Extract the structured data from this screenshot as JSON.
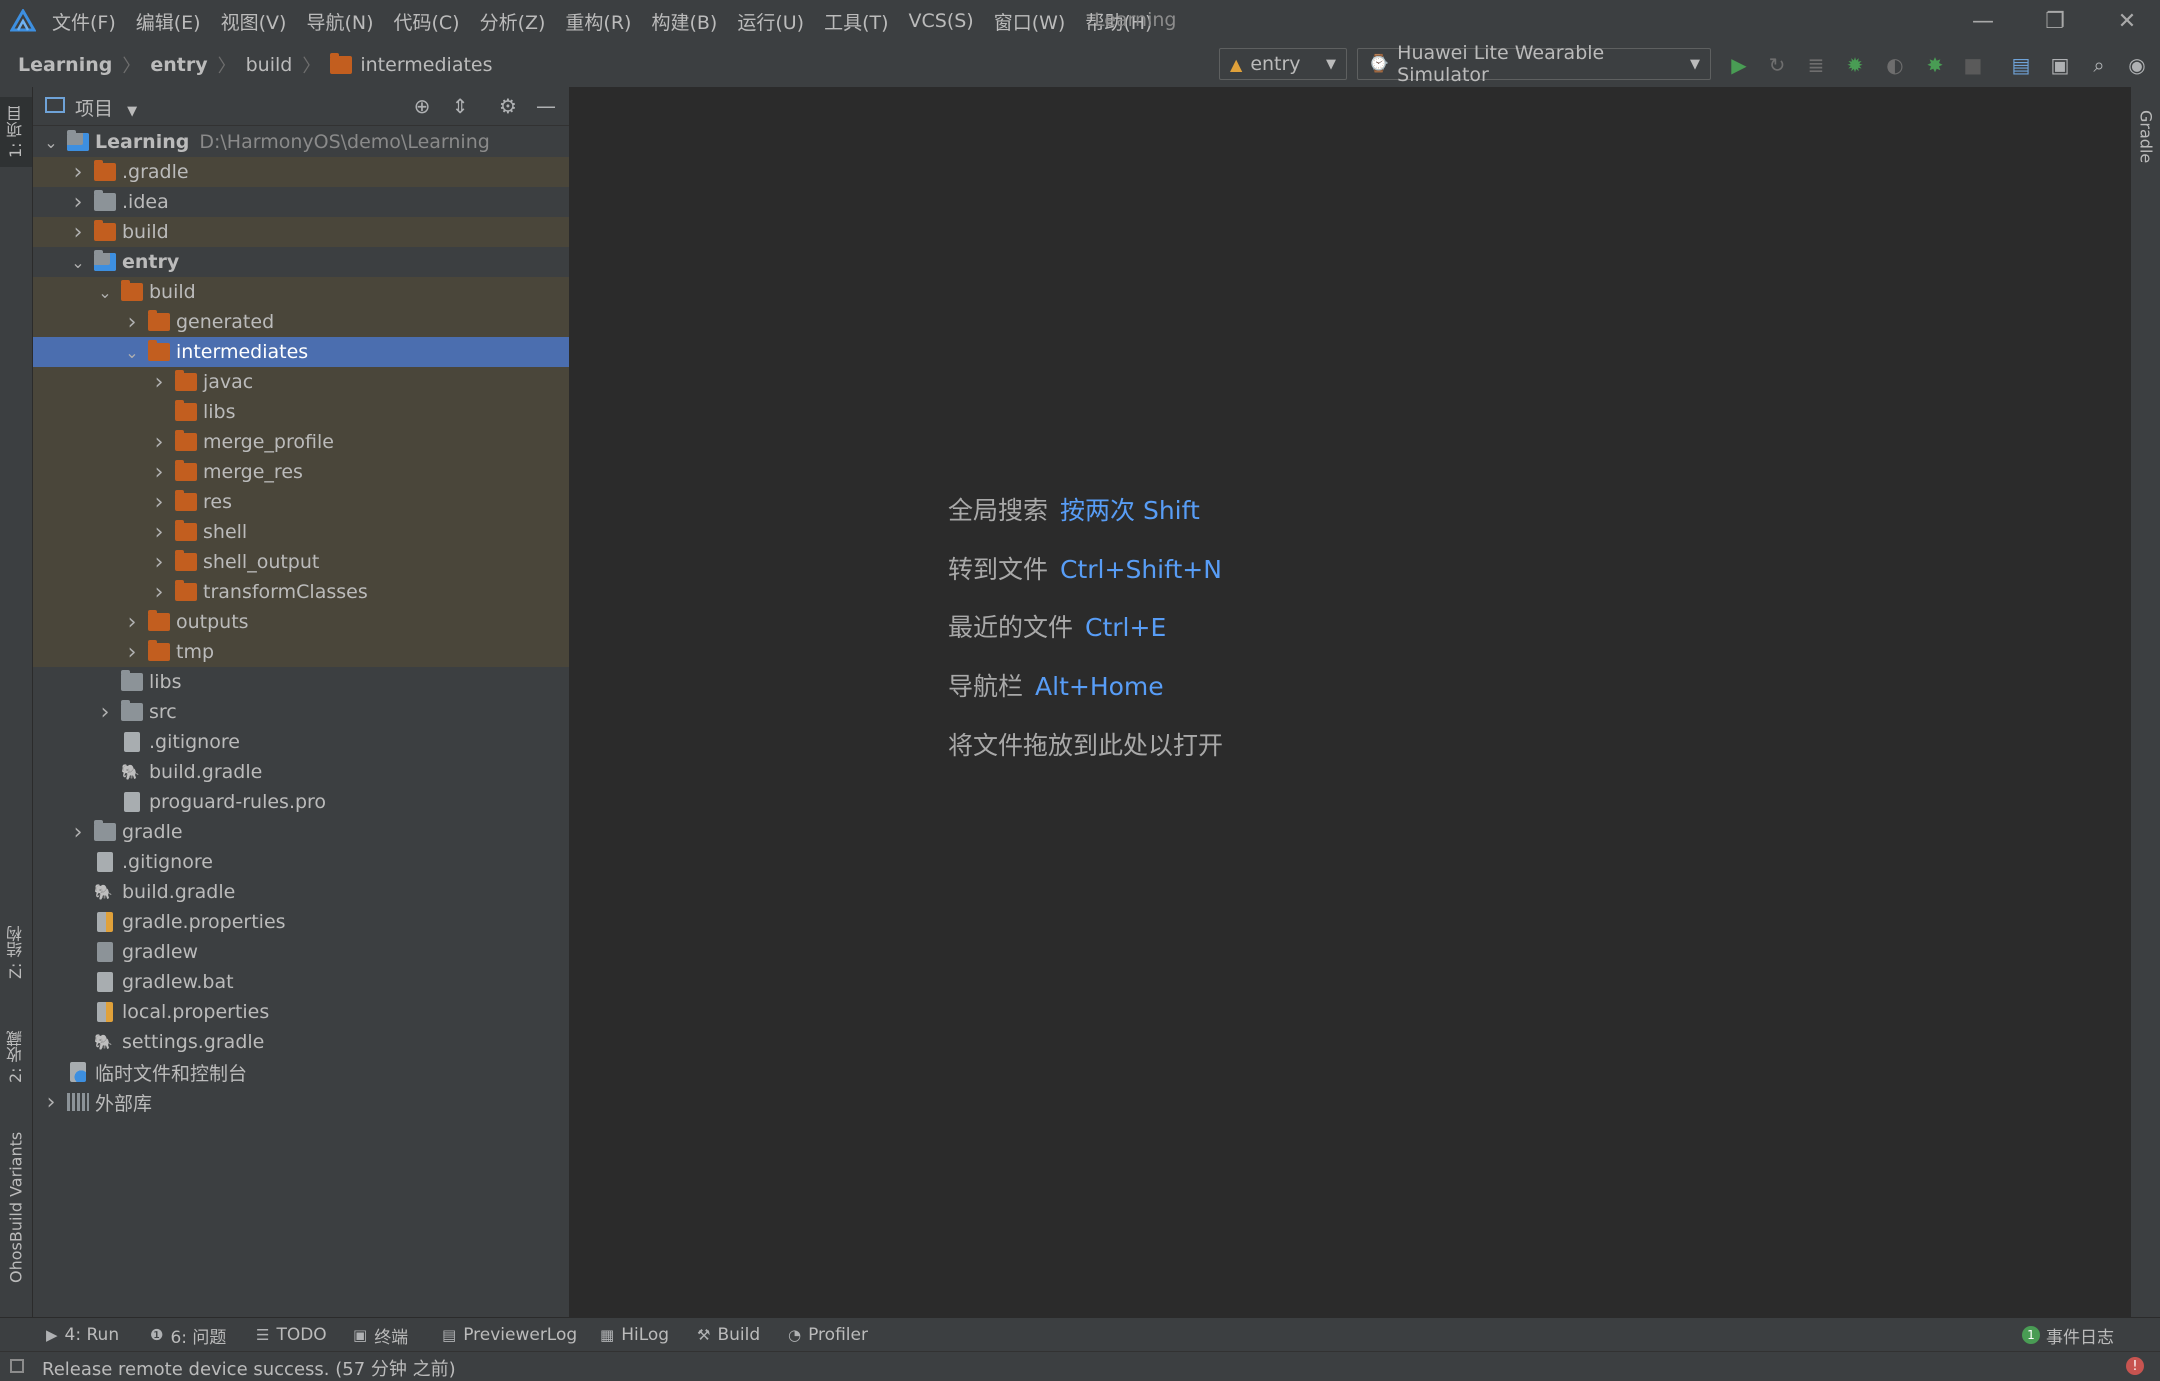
{
  "menubar": {
    "items": [
      "文件(F)",
      "编辑(E)",
      "视图(V)",
      "导航(N)",
      "代码(C)",
      "分析(Z)",
      "重构(R)",
      "构建(B)",
      "运行(U)",
      "工具(T)",
      "VCS(S)",
      "窗口(W)",
      "帮助(H)"
    ],
    "window_title": "Learning"
  },
  "breadcrumb": [
    "Learning",
    "entry",
    "build",
    "intermediates"
  ],
  "toolbar": {
    "run_config": "entry",
    "device": "Huawei Lite Wearable Simulator"
  },
  "left_strip": {
    "project_tab": "1: 项目",
    "structure_tab": "Z: 结构",
    "favorites_tab": "2: 收藏",
    "variants_tab": "OhosBuild Variants"
  },
  "right_strip": {
    "gradle_tab": "Gradle"
  },
  "project_panel": {
    "title": "项目",
    "tree": [
      {
        "indent": 0,
        "arrow": "down",
        "icon": "module",
        "label": "Learning",
        "sub": "D:\\HarmonyOS\\demo\\Learning",
        "bold": true
      },
      {
        "indent": 1,
        "arrow": "right",
        "icon": "folder-orange",
        "label": ".gradle",
        "hl": true
      },
      {
        "indent": 1,
        "arrow": "right",
        "icon": "folder",
        "label": ".idea"
      },
      {
        "indent": 1,
        "arrow": "right",
        "icon": "folder-orange",
        "label": "build",
        "hl": true
      },
      {
        "indent": 1,
        "arrow": "down",
        "icon": "module",
        "label": "entry",
        "bold": true
      },
      {
        "indent": 2,
        "arrow": "down",
        "icon": "folder-orange",
        "label": "build",
        "hl": true
      },
      {
        "indent": 3,
        "arrow": "right",
        "icon": "folder-orange",
        "label": "generated",
        "hl": true
      },
      {
        "indent": 3,
        "arrow": "down",
        "icon": "folder-orange",
        "label": "intermediates",
        "sel": true
      },
      {
        "indent": 4,
        "arrow": "right",
        "icon": "folder-orange",
        "label": "javac",
        "hl": true
      },
      {
        "indent": 4,
        "arrow": "",
        "icon": "folder-orange",
        "label": "libs",
        "hl": true
      },
      {
        "indent": 4,
        "arrow": "right",
        "icon": "folder-orange",
        "label": "merge_profile",
        "hl": true
      },
      {
        "indent": 4,
        "arrow": "right",
        "icon": "folder-orange",
        "label": "merge_res",
        "hl": true
      },
      {
        "indent": 4,
        "arrow": "right",
        "icon": "folder-orange",
        "label": "res",
        "hl": true
      },
      {
        "indent": 4,
        "arrow": "right",
        "icon": "folder-orange",
        "label": "shell",
        "hl": true
      },
      {
        "indent": 4,
        "arrow": "right",
        "icon": "folder-orange",
        "label": "shell_output",
        "hl": true
      },
      {
        "indent": 4,
        "arrow": "right",
        "icon": "folder-orange",
        "label": "transformClasses",
        "hl": true
      },
      {
        "indent": 3,
        "arrow": "right",
        "icon": "folder-orange",
        "label": "outputs",
        "hl": true
      },
      {
        "indent": 3,
        "arrow": "right",
        "icon": "folder-orange",
        "label": "tmp",
        "hl": true
      },
      {
        "indent": 2,
        "arrow": "",
        "icon": "folder",
        "label": "libs"
      },
      {
        "indent": 2,
        "arrow": "right",
        "icon": "folder",
        "label": "src"
      },
      {
        "indent": 2,
        "arrow": "",
        "icon": "file",
        "label": ".gitignore"
      },
      {
        "indent": 2,
        "arrow": "",
        "icon": "gradle",
        "label": "build.gradle"
      },
      {
        "indent": 2,
        "arrow": "",
        "icon": "file",
        "label": "proguard-rules.pro"
      },
      {
        "indent": 1,
        "arrow": "right",
        "icon": "folder",
        "label": "gradle"
      },
      {
        "indent": 1,
        "arrow": "",
        "icon": "file",
        "label": ".gitignore"
      },
      {
        "indent": 1,
        "arrow": "",
        "icon": "gradle",
        "label": "build.gradle"
      },
      {
        "indent": 1,
        "arrow": "",
        "icon": "props",
        "label": "gradle.properties"
      },
      {
        "indent": 1,
        "arrow": "",
        "icon": "shell",
        "label": "gradlew"
      },
      {
        "indent": 1,
        "arrow": "",
        "icon": "file",
        "label": "gradlew.bat"
      },
      {
        "indent": 1,
        "arrow": "",
        "icon": "props",
        "label": "local.properties"
      },
      {
        "indent": 1,
        "arrow": "",
        "icon": "gradle",
        "label": "settings.gradle"
      },
      {
        "indent": 0,
        "arrow": "",
        "icon": "scratch",
        "label": "临时文件和控制台"
      },
      {
        "indent": 0,
        "arrow": "right",
        "icon": "library",
        "label": "外部库"
      }
    ]
  },
  "editor_hints": [
    {
      "text": "全局搜索",
      "key": "按两次 Shift"
    },
    {
      "text": "转到文件",
      "key": "Ctrl+Shift+N"
    },
    {
      "text": "最近的文件",
      "key": "Ctrl+E"
    },
    {
      "text": "导航栏",
      "key": "Alt+Home"
    },
    {
      "text": "将文件拖放到此处以打开",
      "key": ""
    }
  ],
  "tool_windows": {
    "run": "4: Run",
    "problems": "6: 问题",
    "todo": "TODO",
    "terminal": "终端",
    "previewer_log": "PreviewerLog",
    "hilog": "HiLog",
    "build": "Build",
    "profiler": "Profiler",
    "event_log": "事件日志",
    "event_count": "1"
  },
  "status": {
    "message": "Release remote device success. (57 分钟 之前)"
  },
  "colors": {
    "accent": "#4b6eaf",
    "link": "#589df6",
    "excluded_row": "#4a463a",
    "run_green": "#499c54"
  }
}
